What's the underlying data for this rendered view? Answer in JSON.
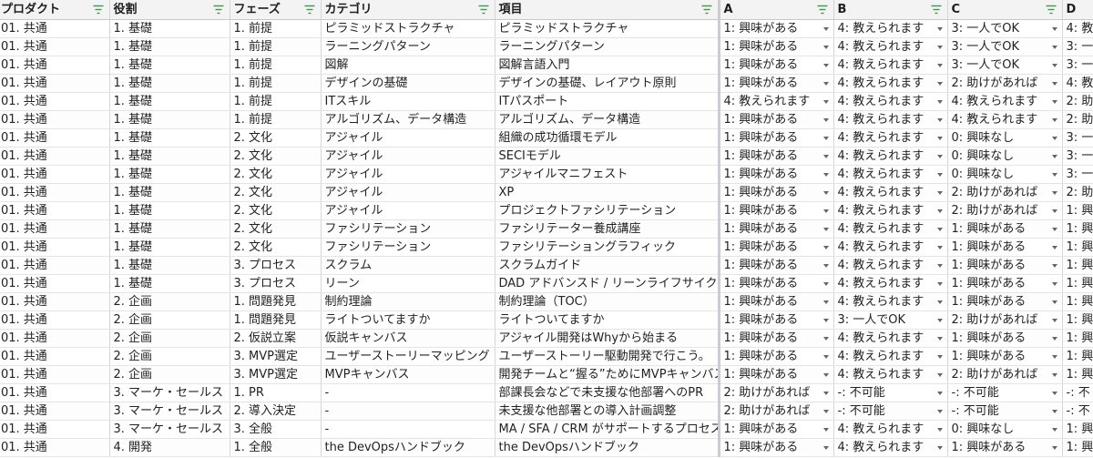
{
  "columns": [
    {
      "key": "product",
      "label": "プロダクト"
    },
    {
      "key": "role",
      "label": "役割"
    },
    {
      "key": "phase",
      "label": "フェーズ"
    },
    {
      "key": "category",
      "label": "カテゴリ"
    },
    {
      "key": "item",
      "label": "項目"
    },
    {
      "key": "a",
      "label": "A"
    },
    {
      "key": "b",
      "label": "B"
    },
    {
      "key": "c",
      "label": "C"
    },
    {
      "key": "d",
      "label": "D"
    }
  ],
  "rows": [
    [
      "01. 共通",
      "1. 基礎",
      "1. 前提",
      "ピラミッドストラクチャ",
      "ピラミッドストラクチャ",
      "1: 興味がある",
      "4: 教えられます",
      "3: 一人でOK",
      "4: 教"
    ],
    [
      "01. 共通",
      "1. 基礎",
      "1. 前提",
      "ラーニングパターン",
      "ラーニングパターン",
      "1: 興味がある",
      "4: 教えられます",
      "3: 一人でOK",
      "3: 一"
    ],
    [
      "01. 共通",
      "1. 基礎",
      "1. 前提",
      "図解",
      "図解言語入門",
      "1: 興味がある",
      "4: 教えられます",
      "3: 一人でOK",
      "3: 一"
    ],
    [
      "01. 共通",
      "1. 基礎",
      "1. 前提",
      "デザインの基礎",
      "デザインの基礎、レイアウト原則",
      "1: 興味がある",
      "4: 教えられます",
      "2: 助けがあれば",
      "4: 教"
    ],
    [
      "01. 共通",
      "1. 基礎",
      "1. 前提",
      "ITスキル",
      "ITパスポート",
      "4: 教えられます",
      "4: 教えられます",
      "4: 教えられます",
      "2: 助"
    ],
    [
      "01. 共通",
      "1. 基礎",
      "1. 前提",
      "アルゴリズム、データ構造",
      "アルゴリズム、データ構造",
      "1: 興味がある",
      "4: 教えられます",
      "4: 教えられます",
      "2: 助"
    ],
    [
      "01. 共通",
      "1. 基礎",
      "2. 文化",
      "アジャイル",
      "組織の成功循環モデル",
      "1: 興味がある",
      "4: 教えられます",
      "0: 興味なし",
      "3: 一"
    ],
    [
      "01. 共通",
      "1. 基礎",
      "2. 文化",
      "アジャイル",
      "SECIモデル",
      "1: 興味がある",
      "4: 教えられます",
      "0: 興味なし",
      "3: 一"
    ],
    [
      "01. 共通",
      "1. 基礎",
      "2. 文化",
      "アジャイル",
      "アジャイルマニフェスト",
      "1: 興味がある",
      "4: 教えられます",
      "0: 興味なし",
      "3: 一"
    ],
    [
      "01. 共通",
      "1. 基礎",
      "2. 文化",
      "アジャイル",
      "XP",
      "1: 興味がある",
      "4: 教えられます",
      "2: 助けがあれば",
      "2: 助"
    ],
    [
      "01. 共通",
      "1. 基礎",
      "2. 文化",
      "アジャイル",
      "プロジェクトファシリテーション",
      "1: 興味がある",
      "4: 教えられます",
      "2: 助けがあれば",
      "1: 興"
    ],
    [
      "01. 共通",
      "1. 基礎",
      "2. 文化",
      "ファシリテーション",
      "ファシリテーター養成講座",
      "1: 興味がある",
      "4: 教えられます",
      "1: 興味がある",
      "1: 興"
    ],
    [
      "01. 共通",
      "1. 基礎",
      "2. 文化",
      "ファシリテーション",
      "ファシリテーショングラフィック",
      "1: 興味がある",
      "4: 教えられます",
      "1: 興味がある",
      "1: 興"
    ],
    [
      "01. 共通",
      "1. 基礎",
      "3. プロセス",
      "スクラム",
      "スクラムガイド",
      "1: 興味がある",
      "4: 教えられます",
      "1: 興味がある",
      "1: 興"
    ],
    [
      "01. 共通",
      "1. 基礎",
      "3. プロセス",
      "リーン",
      "DAD アドバンスド / リーンライフサイクル",
      "1: 興味がある",
      "4: 教えられます",
      "1: 興味がある",
      "1: 興"
    ],
    [
      "01. 共通",
      "2. 企画",
      "1. 問題発見",
      "制約理論",
      "制約理論（TOC）",
      "1: 興味がある",
      "4: 教えられます",
      "1: 興味がある",
      "1: 興"
    ],
    [
      "01. 共通",
      "2. 企画",
      "1. 問題発見",
      "ライトついてますか",
      "ライトついてますか",
      "1: 興味がある",
      "3: 一人でOK",
      "2: 助けがあれば",
      "1: 興"
    ],
    [
      "01. 共通",
      "2. 企画",
      "2. 仮説立案",
      "仮説キャンバス",
      "アジャイル開発はWhyから始まる",
      "1: 興味がある",
      "4: 教えられます",
      "1: 興味がある",
      "1: 興"
    ],
    [
      "01. 共通",
      "2. 企画",
      "3. MVP選定",
      "ユーザーストーリーマッピング",
      "ユーザーストーリー駆動開発で行こう。",
      "1: 興味がある",
      "4: 教えられます",
      "1: 興味がある",
      "1: 興"
    ],
    [
      "01. 共通",
      "2. 企画",
      "3. MVP選定",
      "MVPキャンバス",
      "開発チームと“握る”ためにMVPキャンバスを",
      "1: 興味がある",
      "4: 教えられます",
      "2: 助けがあれば",
      "1: 興"
    ],
    [
      "01. 共通",
      "3. マーケ・セールス",
      "1. PR",
      "-",
      "部課長会などで未支援な他部署へのPR",
      "2: 助けがあれば",
      "-: 不可能",
      "-: 不可能",
      "-: 不"
    ],
    [
      "01. 共通",
      "3. マーケ・セールス",
      "2. 導入決定",
      "-",
      "未支援な他部署との導入計画調整",
      "2: 助けがあれば",
      "-: 不可能",
      "-: 不可能",
      "-: 不"
    ],
    [
      "01. 共通",
      "3. マーケ・セールス",
      "3. 全般",
      "-",
      "MA / SFA / CRM がサポートするプロセス",
      "1: 興味がある",
      "4: 教えられます",
      "0: 興味なし",
      "1: 興"
    ],
    [
      "01. 共通",
      "4. 開発",
      "1. 全般",
      "the DevOpsハンドブック",
      "the DevOpsハンドブック",
      "1: 興味がある",
      "4: 教えられます",
      "1: 興味がある",
      "1: 興"
    ]
  ],
  "icons": {
    "filter": "filter-icon",
    "dropdown": "chevron-down-icon"
  },
  "colors": {
    "filter_icon": "#3a9a4f",
    "header_bg": "#f3f3f3",
    "grid_line": "#d6d6d6"
  }
}
